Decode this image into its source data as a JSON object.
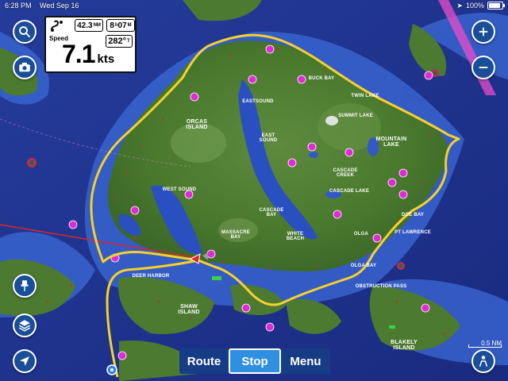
{
  "status": {
    "time": "6:28 PM",
    "date": "Wed Sep 16",
    "battery_percent": "100%",
    "battery_level": 1.0
  },
  "instruments": {
    "distance": "42.3",
    "distance_unit": "NM",
    "eta_hours": "8",
    "eta_h": "h",
    "eta_minutes": "07",
    "eta_m": "M",
    "speed_label": "Speed",
    "speed_value": "7.1",
    "speed_unit": "kts",
    "heading": "282°",
    "heading_unit": "T"
  },
  "nav": {
    "route": "Route",
    "stop": "Stop",
    "menu": "Menu",
    "active": "Stop"
  },
  "scale": {
    "value": "0.5",
    "unit": "NM"
  },
  "map_labels": {
    "orcas_island": "ORCAS\nISLAND",
    "mountain_lake": "MOUNTAIN\nLAKE",
    "east_sound": "EAST\nSOUND",
    "west_sound": "WEST SOUND",
    "shaw_island": "SHAW\nISLAND",
    "blakely_island": "BLAKELY\nISLAND",
    "twin_lake": "TWIN LAKE",
    "summit_lake": "SUMMIT LAKE",
    "cascade_lake": "CASCADE LAKE",
    "cascade_creek": "CASCADE\nCREEK",
    "cascade_bay": "CASCADE\nBAY",
    "buck_bay": "BUCK BAY",
    "olga": "OLGA",
    "pt_lawrence": "PT LAWRENCE",
    "doe_bay": "DOE BAY",
    "olga_bay": "OLGA BAY",
    "white_beach": "WHITE\nBEACH",
    "deer_harbor": "DEER HARBOR",
    "massacre_bay": "MASSACRE\nBAY",
    "eastsound": "EASTSOUND",
    "obstruction_pass": "OBSTRUCTION PASS"
  },
  "colors": {
    "water": "#1b2f8a",
    "shallow": "#3b6bd6",
    "land": "#4f7a32",
    "route": "#f6d12b",
    "button": "#1a4e98",
    "active_button": "#2f8fe0"
  }
}
